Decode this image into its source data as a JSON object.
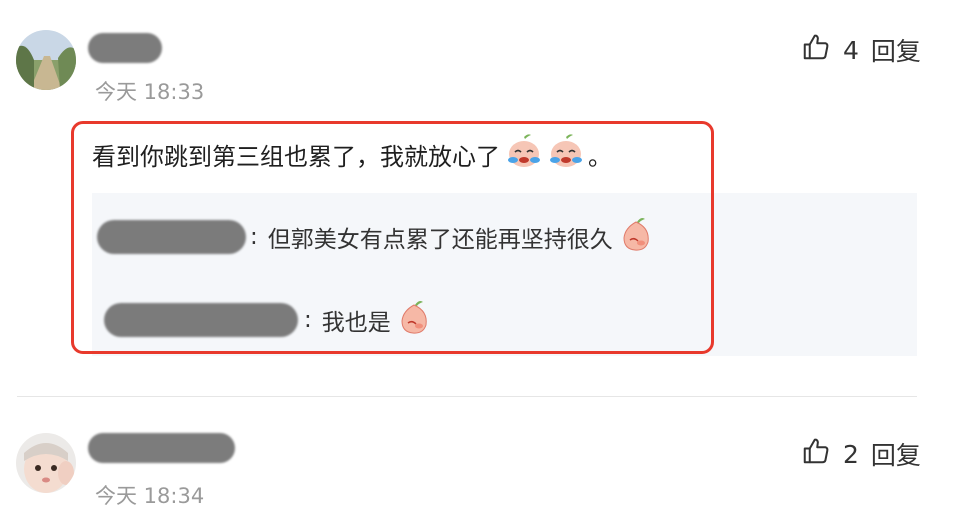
{
  "comments": [
    {
      "username": "",
      "time": "今天 18:33",
      "likes": {
        "count_label": "4",
        "reply_label": "回复"
      },
      "text": "看到你跳到第三组也累了，我就放心了",
      "suffix": "。",
      "replies": [
        {
          "username": "",
          "separator": ":",
          "text": "但郭美女有点累了还能再坚持很久"
        },
        {
          "username": "",
          "separator": ":",
          "text": "我也是"
        }
      ]
    },
    {
      "username": "",
      "time": "今天 18:34",
      "likes": {
        "count_label": "2",
        "reply_label": "回复"
      }
    }
  ],
  "colors": {
    "highlight_border": "#e8392c",
    "reply_bg": "#f5f7fa",
    "time_text": "#9a9a9a"
  },
  "icons": {
    "like": "thumbs-up-icon",
    "emoji_cry": "crying-face-emoji",
    "emoji_shy": "shy-peach-emoji"
  }
}
